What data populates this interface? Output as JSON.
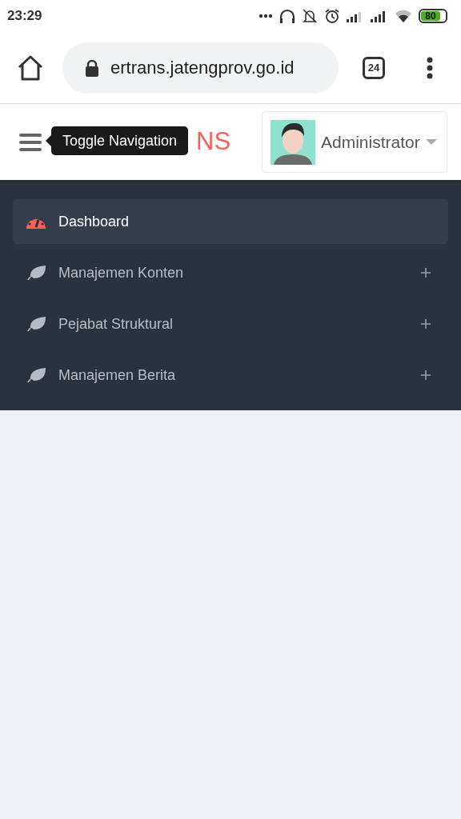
{
  "status_bar": {
    "time": "23:29",
    "battery": "80"
  },
  "browser": {
    "url": "ertrans.jatengprov.go.id",
    "tab_count": "24"
  },
  "header": {
    "logo": "NS",
    "tooltip": "Toggle Navigation",
    "user": "Administrator"
  },
  "sidebar": {
    "items": [
      {
        "label": "Dashboard",
        "kind": "gauge",
        "selected": true,
        "expandable": false
      },
      {
        "label": "Manajemen Konten",
        "kind": "leaf",
        "selected": false,
        "expandable": true
      },
      {
        "label": "Pejabat Struktural",
        "kind": "leaf",
        "selected": false,
        "expandable": true
      },
      {
        "label": "Manajemen Berita",
        "kind": "leaf",
        "selected": false,
        "expandable": true
      }
    ]
  }
}
